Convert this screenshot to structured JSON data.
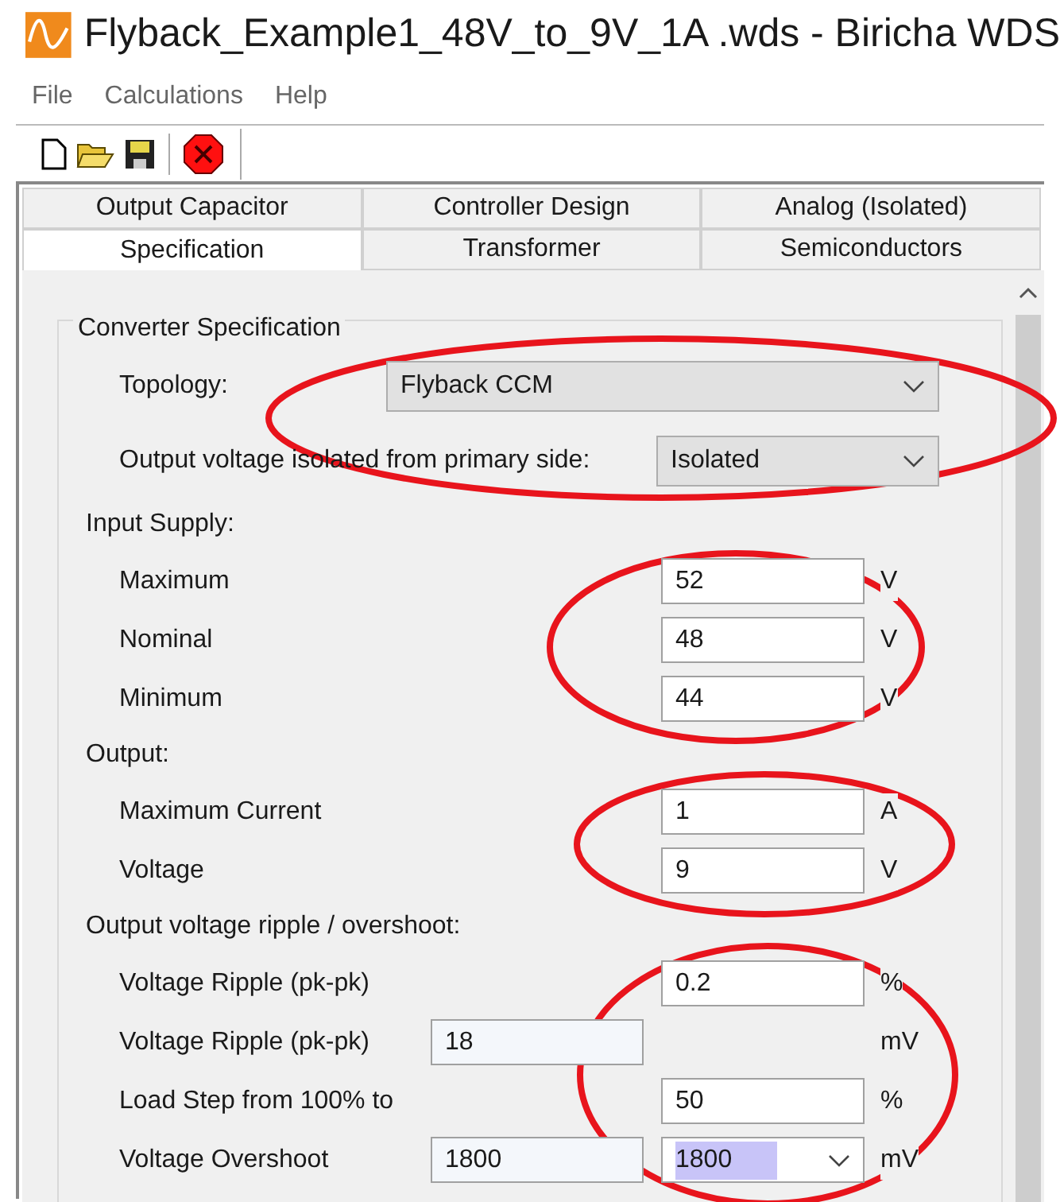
{
  "window": {
    "title": "Flyback_Example1_48V_to_9V_1A .wds - Biricha WDS"
  },
  "menu": [
    "File",
    "Calculations",
    "Help"
  ],
  "tabs": [
    [
      {
        "label": "Output Capacitor",
        "selected": false
      },
      {
        "label": "Controller Design",
        "selected": false
      },
      {
        "label": "Analog (Isolated)",
        "selected": false
      }
    ],
    [
      {
        "label": "Specification",
        "selected": true
      },
      {
        "label": "Transformer",
        "selected": false
      },
      {
        "label": "Semiconductors",
        "selected": false
      }
    ]
  ],
  "group": {
    "title": "Converter Specification"
  },
  "rows": [
    {
      "kind": "topology",
      "label": "Topology:",
      "field": {
        "value": "Flyback CCM"
      }
    },
    {
      "kind": "isolation",
      "label": "Output voltage isolated from primary side:",
      "field": {
        "value": "Isolated"
      }
    },
    {
      "kind": "heading",
      "label": "Input Supply:"
    },
    {
      "kind": "input",
      "label": "Maximum",
      "fields": [
        {
          "kind": "text",
          "value": "52"
        }
      ],
      "unit": "V"
    },
    {
      "kind": "input",
      "label": "Nominal",
      "fields": [
        {
          "kind": "text",
          "value": "48"
        }
      ],
      "unit": "V"
    },
    {
      "kind": "input",
      "label": "Minimum",
      "fields": [
        {
          "kind": "text",
          "value": "44"
        }
      ],
      "unit": "V"
    },
    {
      "kind": "heading",
      "label": "Output:"
    },
    {
      "kind": "input",
      "label": "Maximum Current",
      "fields": [
        {
          "kind": "text",
          "value": "1"
        }
      ],
      "unit": "A"
    },
    {
      "kind": "input",
      "label": "Voltage",
      "fields": [
        {
          "kind": "text",
          "value": "9"
        }
      ],
      "unit": "V"
    },
    {
      "kind": "heading",
      "label": "Output voltage ripple / overshoot:"
    },
    {
      "kind": "input",
      "label": "Voltage Ripple (pk-pk)",
      "fields": [
        {
          "kind": "text",
          "value": "0.2"
        }
      ],
      "unit": "%"
    },
    {
      "kind": "input",
      "label": "Voltage Ripple (pk-pk)",
      "fields": [
        {
          "kind": "readonly",
          "value": "18"
        }
      ],
      "unit": "mV"
    },
    {
      "kind": "input",
      "label": "Load Step from 100% to",
      "fields": [
        {
          "kind": "text",
          "value": "50"
        }
      ],
      "unit": "%"
    },
    {
      "kind": "input",
      "label": "Voltage Overshoot",
      "fields": [
        {
          "kind": "readonly",
          "value": "1800"
        },
        {
          "kind": "combo",
          "value": "1800",
          "highlighted": true
        }
      ],
      "unit": "mV"
    }
  ]
}
